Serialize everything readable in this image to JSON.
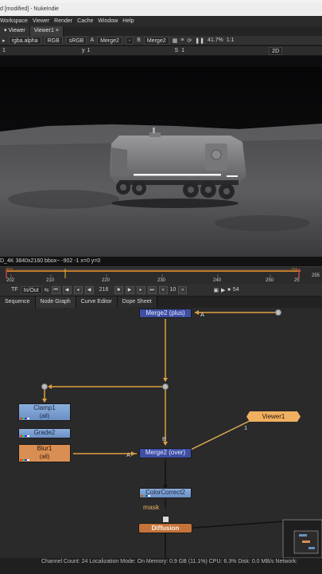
{
  "window": {
    "title": "d [modified] - NukeIndie"
  },
  "menu": [
    "Workspace",
    "Viewer",
    "Render",
    "Cache",
    "Window",
    "Help"
  ],
  "viewer_tabs": [
    "Viewer",
    "Viewer1"
  ],
  "viewer_controls": {
    "channels": "rgba.alpha",
    "rgb": "RGB",
    "colorspace": "sRGB",
    "a_input": "Merge2",
    "b_input": "Merge2",
    "a_label": "A",
    "b_label": "B",
    "zoom": "41.7%",
    "ratio": "1:1",
    "row2_left": "1",
    "y_label": "y",
    "y_value": "1",
    "s_label": "S",
    "s_value": "1",
    "view_mode": "2D"
  },
  "viewer_info": "D_4K 3840x2160  bbox~ -902 -1 x=0 y=0",
  "timeline": {
    "start_label": "202",
    "ticks": [
      "202",
      "210",
      "220",
      "230",
      "240",
      "250",
      "25"
    ],
    "end_value": "255",
    "top_left_marker": "202",
    "top_right_marker": "255"
  },
  "playback": {
    "tf": "TF",
    "range_mode": "In/Out",
    "frame": "216",
    "increment": "10",
    "end_frame": "54"
  },
  "panel_tabs": [
    "Sequence",
    "Node Graph",
    "Curve Editor",
    "Dope Sheet"
  ],
  "nodes": {
    "merge_top": "Merge2 (plus)",
    "clamp_name": "Clamp1",
    "clamp_sub": "(all)",
    "grade": "Grade2",
    "blur_name": "Blur1",
    "blur_sub": "(all)",
    "merge_over": "Merge2 (over)",
    "viewer": "Viewer1",
    "colorcorrect": "ColorCorrect2",
    "diffusion": "Diffusion"
  },
  "edge_labels": {
    "a_top": "A",
    "a_merge": "A",
    "b_merge": "B",
    "viewer_input": "1",
    "mask": "mask"
  },
  "status": "Channel Count: 24  Localization Mode: On  Memory: 0.9 GB (11.1%)  CPU: 6.3%  Disk: 0.0 MB/s  Network:",
  "colors": {
    "wire": "#e0a040",
    "node_blue": "#7aa0d2",
    "node_merge": "#3e4ea4",
    "node_orange": "#d98f53",
    "viewer_node": "#f0b060"
  }
}
